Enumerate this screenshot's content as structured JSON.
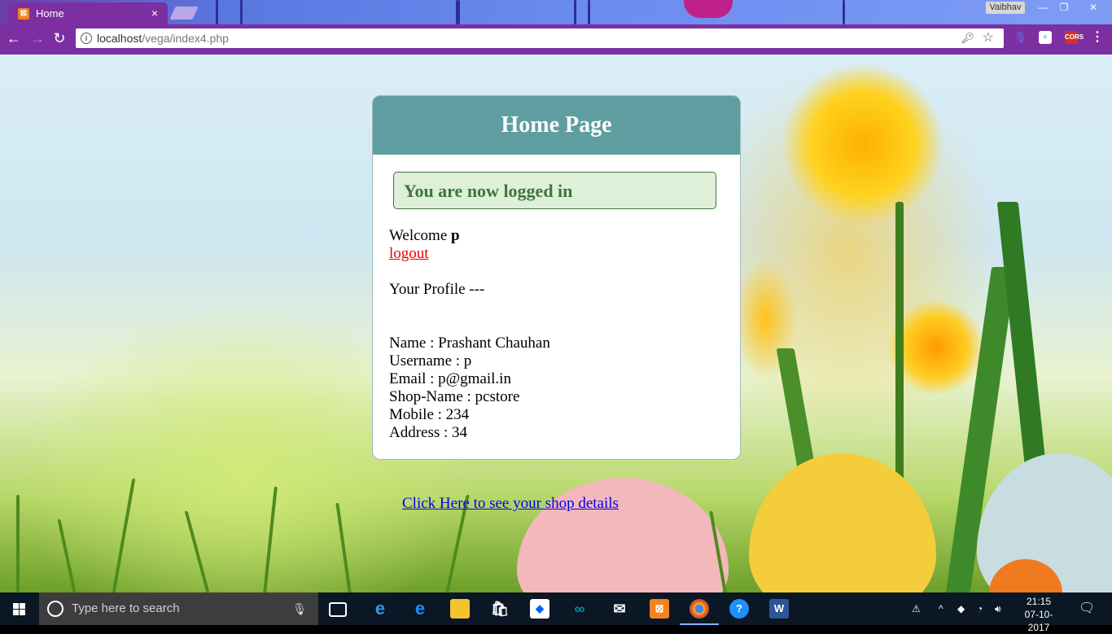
{
  "browser": {
    "tab_title": "Home",
    "tab_close": "×",
    "profile_name": "Vaibhav",
    "url_host": "localhost",
    "url_path": "/vega/index4.php",
    "extension_cors": "CORS"
  },
  "card": {
    "title": "Home Page",
    "alert": "You are now logged in",
    "welcome_prefix": "Welcome",
    "welcome_user": "p",
    "logout_label": "logout",
    "profile_heading": "Your Profile ---",
    "profile": [
      "Name : Prashant Chauhan",
      "Username : p",
      "Email : p@gmail.in",
      "Shop-Name : pcstore",
      "Mobile : 234",
      "Address : 34"
    ]
  },
  "shop_link": "Click Here to see your shop details",
  "taskbar": {
    "search_placeholder": "Type here to search",
    "time": "21:15",
    "date": "07-10-2017"
  }
}
